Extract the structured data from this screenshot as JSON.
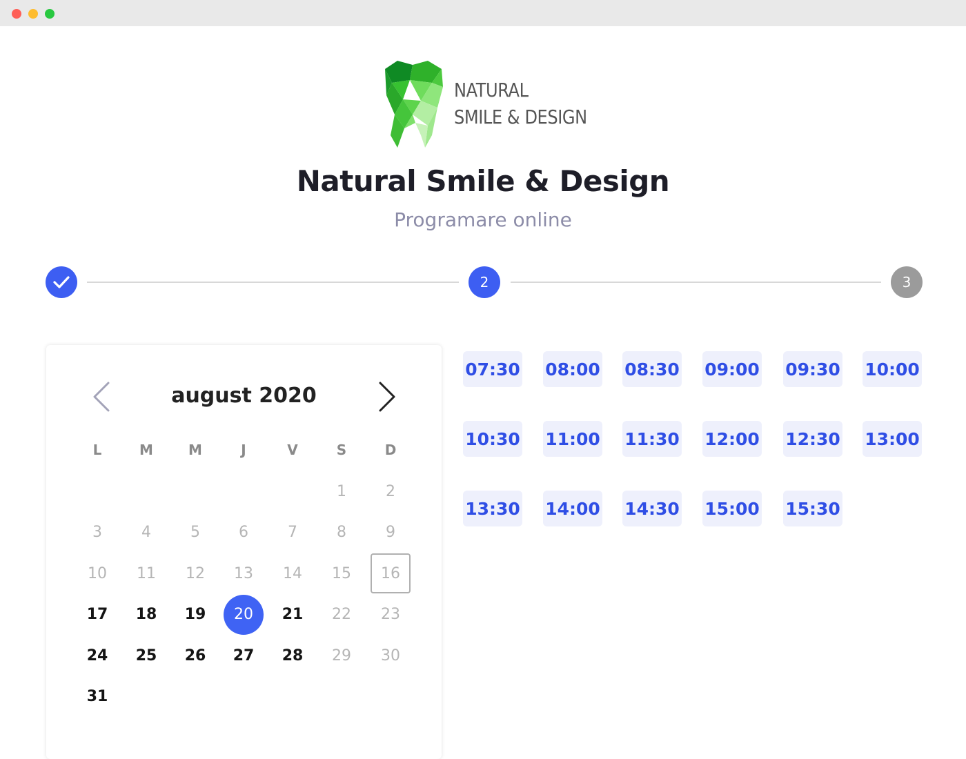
{
  "logo": {
    "line1": "NATURAL",
    "line2": "SMILE & DESIGN",
    "colors": [
      "#0b7f1e",
      "#2fb12a",
      "#5ddb4a",
      "#9be88a"
    ]
  },
  "header": {
    "title": "Natural Smile & Design",
    "subtitle": "Programare online"
  },
  "stepper": {
    "steps": [
      {
        "label": "",
        "state": "done",
        "icon": "check-icon"
      },
      {
        "label": "2",
        "state": "current"
      },
      {
        "label": "3",
        "state": "upcoming"
      }
    ]
  },
  "calendar": {
    "month_label": "august 2020",
    "prev_icon": "chevron-left-icon",
    "next_icon": "chevron-right-icon",
    "weekdays": [
      "L",
      "M",
      "M",
      "J",
      "V",
      "S",
      "D"
    ],
    "first_weekday_index": 5,
    "days_in_month": 31,
    "available_days": [
      17,
      18,
      19,
      20,
      21,
      24,
      25,
      26,
      27,
      28,
      31
    ],
    "selected_day": 20,
    "today": 16
  },
  "time_slots": [
    "07:30",
    "08:00",
    "08:30",
    "09:00",
    "09:30",
    "10:00",
    "10:30",
    "11:00",
    "11:30",
    "12:00",
    "12:30",
    "13:00",
    "13:30",
    "14:00",
    "14:30",
    "15:00",
    "15:30"
  ],
  "colors": {
    "accent": "#3d5ef2",
    "inactive_step": "#9b9b9b",
    "slot_bg": "#eef0fc",
    "slot_text": "#2f4ee5"
  }
}
